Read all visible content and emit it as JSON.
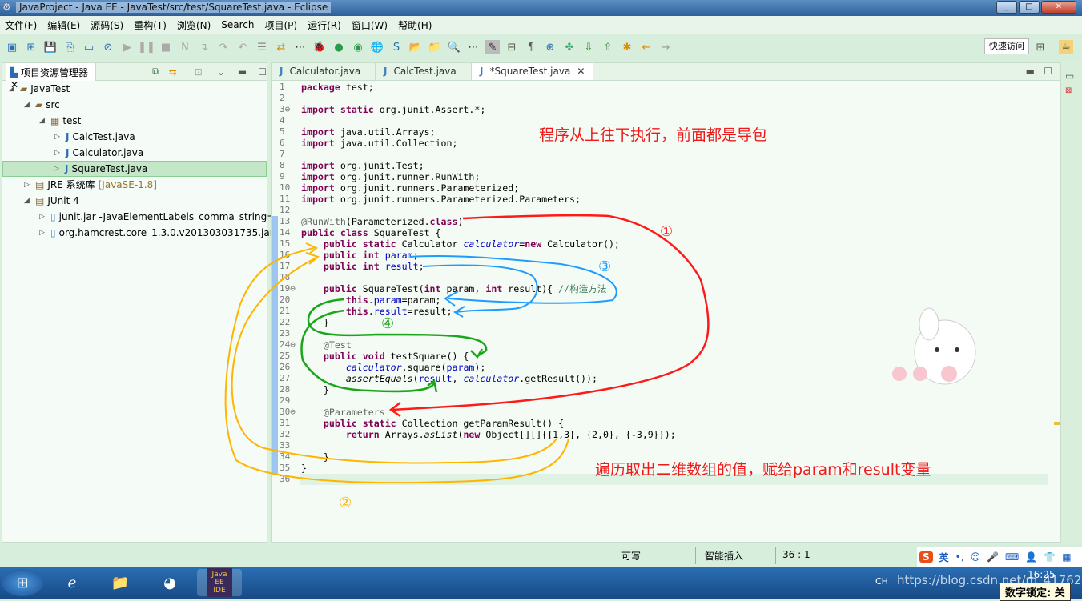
{
  "window": {
    "title": "JavaProject - Java EE - JavaTest/src/test/SquareTest.java - Eclipse",
    "min": "_",
    "max": "□",
    "close": "✕"
  },
  "menu": [
    "文件(F)",
    "编辑(E)",
    "源码(S)",
    "重构(T)",
    "浏览(N)",
    "Search",
    "项目(P)",
    "运行(R)",
    "窗口(W)",
    "帮助(H)"
  ],
  "toolbar": {
    "quick_access": "快速访问"
  },
  "explorer": {
    "title": "项目资源管理器",
    "items": [
      {
        "label": "JavaTest",
        "depth": 0,
        "expanded": true,
        "icon": "project-icon"
      },
      {
        "label": "src",
        "depth": 1,
        "expanded": true,
        "icon": "source-folder-icon"
      },
      {
        "label": "test",
        "depth": 2,
        "expanded": true,
        "icon": "package-icon"
      },
      {
        "label": "CalcTest.java",
        "depth": 3,
        "expanded": false,
        "icon": "java-file-icon"
      },
      {
        "label": "Calculator.java",
        "depth": 3,
        "expanded": false,
        "icon": "java-file-icon"
      },
      {
        "label": "SquareTest.java",
        "depth": 3,
        "expanded": false,
        "icon": "java-file-icon",
        "selected": true
      },
      {
        "label": "JRE 系统库",
        "suffix": "[JavaSE-1.8]",
        "depth": 1,
        "expanded": false,
        "icon": "library-icon"
      },
      {
        "label": "JUnit 4",
        "depth": 1,
        "expanded": true,
        "icon": "library-icon"
      },
      {
        "label": "junit.jar -JavaElementLabels_comma_string=",
        "depth": 2,
        "expanded": false,
        "icon": "jar-icon"
      },
      {
        "label": "org.hamcrest.core_1.3.0.v201303031735.jar",
        "depth": 2,
        "expanded": false,
        "icon": "jar-icon"
      }
    ]
  },
  "editor": {
    "tabs": [
      {
        "label": "Calculator.java"
      },
      {
        "label": "CalcTest.java"
      },
      {
        "label": "*SquareTest.java",
        "active": true
      }
    ],
    "lines": [
      [
        [
          "package",
          "kw"
        ],
        [
          " test;",
          ""
        ]
      ],
      [],
      [
        [
          "import static",
          "kw"
        ],
        [
          " org.junit.Assert.*;",
          ""
        ]
      ],
      [],
      [
        [
          "import",
          "kw"
        ],
        [
          " java.util.Arrays;",
          ""
        ]
      ],
      [
        [
          "import",
          "kw"
        ],
        [
          " java.util.Collection;",
          ""
        ]
      ],
      [],
      [
        [
          "import",
          "kw"
        ],
        [
          " org.junit.Test;",
          ""
        ]
      ],
      [
        [
          "import",
          "kw"
        ],
        [
          " org.junit.runner.RunWith;",
          ""
        ]
      ],
      [
        [
          "import",
          "kw"
        ],
        [
          " org.junit.runners.Parameterized;",
          ""
        ]
      ],
      [
        [
          "import",
          "kw"
        ],
        [
          " org.junit.runners.Parameterized.Parameters;",
          ""
        ]
      ],
      [],
      [
        [
          "@RunWith",
          "an"
        ],
        [
          "(Parameterized.",
          ""
        ],
        [
          "class",
          "kw"
        ],
        [
          ")",
          ""
        ]
      ],
      [
        [
          "public class",
          "kw"
        ],
        [
          " SquareTest {",
          ""
        ]
      ],
      [
        [
          "    public static",
          "kw"
        ],
        [
          " Calculator ",
          ""
        ],
        [
          "calculator",
          "st"
        ],
        [
          "=",
          ""
        ],
        [
          "new",
          "kw"
        ],
        [
          " Calculator();",
          ""
        ]
      ],
      [
        [
          "    public int",
          "kw"
        ],
        [
          " ",
          ""
        ],
        [
          "param",
          "fd"
        ],
        [
          ";",
          ""
        ]
      ],
      [
        [
          "    public int",
          "kw"
        ],
        [
          " ",
          ""
        ],
        [
          "result",
          "fd"
        ],
        [
          ";",
          ""
        ]
      ],
      [],
      [
        [
          "    public",
          "kw"
        ],
        [
          " SquareTest(",
          ""
        ],
        [
          "int",
          "kw"
        ],
        [
          " param, ",
          ""
        ],
        [
          "int",
          "kw"
        ],
        [
          " result){ ",
          ""
        ],
        [
          "//构造方法",
          "cm"
        ]
      ],
      [
        [
          "        this",
          "kw"
        ],
        [
          ".",
          ""
        ],
        [
          "param",
          "fd"
        ],
        [
          "=param;",
          ""
        ]
      ],
      [
        [
          "        this",
          "kw"
        ],
        [
          ".",
          ""
        ],
        [
          "result",
          "fd"
        ],
        [
          "=result;",
          ""
        ]
      ],
      [
        [
          "    }",
          ""
        ]
      ],
      [],
      [
        [
          "    @Test",
          "an"
        ]
      ],
      [
        [
          "    public void",
          "kw"
        ],
        [
          " testSquare() {",
          ""
        ]
      ],
      [
        [
          "        ",
          ""
        ],
        [
          "calculator",
          "st"
        ],
        [
          ".square(",
          ""
        ],
        [
          "param",
          "fd"
        ],
        [
          ");",
          ""
        ]
      ],
      [
        [
          "        ",
          ""
        ],
        [
          "assertEquals",
          "sm"
        ],
        [
          "(",
          ""
        ],
        [
          "result",
          "fd"
        ],
        [
          ", ",
          ""
        ],
        [
          "calculator",
          "st"
        ],
        [
          ".getResult());",
          ""
        ]
      ],
      [
        [
          "    }",
          ""
        ]
      ],
      [],
      [
        [
          "    @Parameters",
          "an"
        ]
      ],
      [
        [
          "    public static",
          "kw"
        ],
        [
          " Collection getParamResult() {",
          ""
        ]
      ],
      [
        [
          "        return",
          "kw"
        ],
        [
          " Arrays.",
          ""
        ],
        [
          "asList",
          "sm"
        ],
        [
          "(",
          ""
        ],
        [
          "new",
          "kw"
        ],
        [
          " Object[][]{{1,3}, {2,0}, {-3,9}});",
          ""
        ]
      ],
      [],
      [
        [
          "    }",
          ""
        ]
      ],
      [
        [
          "}",
          ""
        ]
      ],
      []
    ]
  },
  "annotations": {
    "note_top": "程序从上往下执行，前面都是导包",
    "note_bottom": "遍历取出二维数组的值，赋给param和result变量",
    "step1": "①",
    "step2": "②",
    "step3": "③",
    "step4": "④",
    "colors": {
      "step1": "#ff1a1a",
      "step2": "#ffb400",
      "step3": "#1e9bff",
      "step4": "#1aa51a"
    }
  },
  "status": {
    "writable": "可写",
    "insert_mode": "智能插入",
    "position": "36 : 1"
  },
  "ime": {
    "lang": "英",
    "punct": "•,"
  },
  "taskbar": {
    "time": "16:25",
    "lang": "CH",
    "numlock": "数字锁定: 关",
    "watermark": "https://blog.csdn.net/m_41762425",
    "ide_label": "Java EE IDE"
  }
}
